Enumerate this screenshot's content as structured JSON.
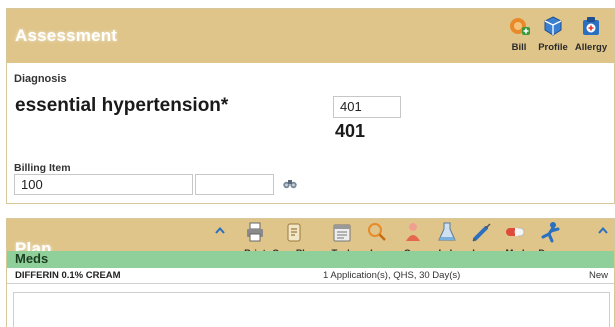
{
  "assessment": {
    "title": "Assessment",
    "toolbar": [
      {
        "label": "Bill",
        "icon": "bill-add-icon"
      },
      {
        "label": "Profile",
        "icon": "profile-cube-icon"
      },
      {
        "label": "Allergy",
        "icon": "allergy-icon"
      }
    ],
    "diagnosis_label": "Diagnosis",
    "diagnosis_value": "essential hypertension*",
    "code_input_value": "401",
    "code_display": "401",
    "billing_label": "Billing Item",
    "billing_value": "100",
    "billing_modifier_value": ""
  },
  "plan": {
    "title": "Plan",
    "toolbar": [
      {
        "label": "Print",
        "icon": "printer-icon"
      },
      {
        "label": "Care Plan",
        "icon": "care-plan-icon"
      },
      {
        "label": "Task",
        "icon": "task-calendar-icon"
      },
      {
        "label": "Inv",
        "icon": "investigation-magnifier-icon"
      },
      {
        "label": "Con",
        "icon": "consult-person-icon"
      },
      {
        "label": "Lab",
        "icon": "lab-flask-icon"
      },
      {
        "label": "Imm",
        "icon": "immunization-syringe-icon"
      },
      {
        "label": "Med",
        "icon": "medication-pill-icon"
      },
      {
        "label": "Draw",
        "icon": "draw-figure-icon"
      }
    ],
    "meds_header": "Meds",
    "meds": [
      {
        "name": "DIFFERIN 0.1% CREAM",
        "sig": "1 Application(s), QHS, 30 Day(s)",
        "status": "New"
      }
    ]
  },
  "colors": {
    "header_bg": "#dfc58a",
    "meds_bar": "#8fcf9a",
    "icon_blue": "#2a6fc0",
    "icon_orange": "#e88a2a"
  }
}
